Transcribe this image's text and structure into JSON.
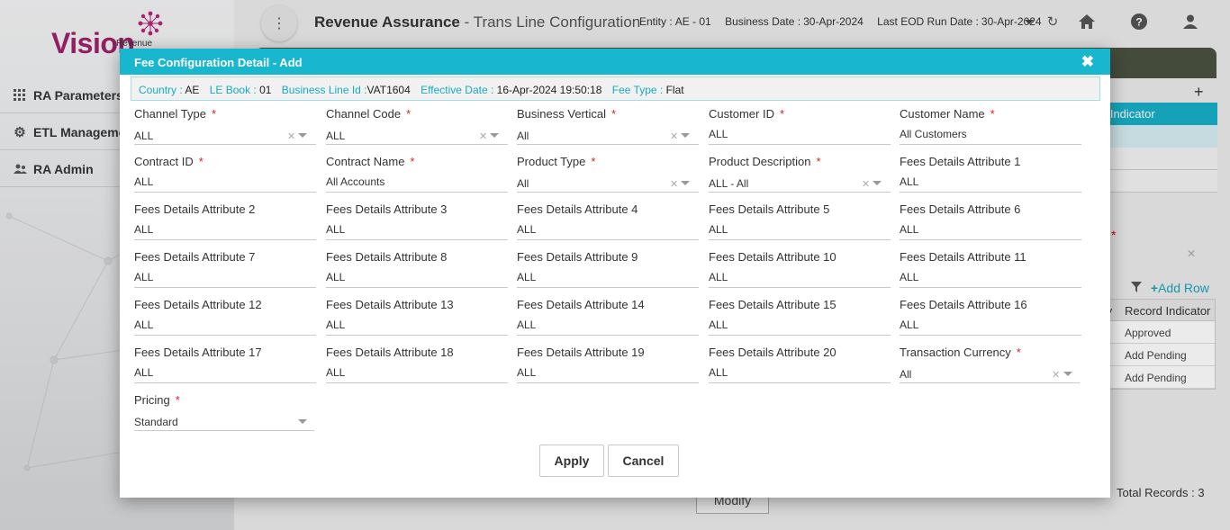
{
  "sidebar": {
    "logo_text": "Vision",
    "logo_sub": "Revenue",
    "items": [
      {
        "label": "RA Parameters",
        "icon": "grid-icon"
      },
      {
        "label": "ETL Manageme",
        "icon": "gear-icon"
      },
      {
        "label": "RA Admin",
        "icon": "users-icon"
      }
    ]
  },
  "header": {
    "title_bold": "Revenue Assurance",
    "title_rest": " - Trans Line Configuration",
    "entity_label": "Entity :",
    "entity_value": "AE - 01",
    "business_date_label": "Business Date :",
    "business_date_value": "30-Apr-2024",
    "eod_label": "Last EOD Run Date :",
    "eod_value": "30-Apr-2024"
  },
  "background": {
    "indicator_header": "d Indicator",
    "add_row_label": "Add Row",
    "record_indicator_header": "Record Indicator",
    "header_cut": "fy",
    "rows": [
      "Approved",
      "Add Pending",
      "Add Pending"
    ],
    "total_records_label": "Total Records",
    "total_records_value": "3",
    "modify_label": "Modify"
  },
  "modal": {
    "title": "Fee Configuration Detail - Add",
    "info": {
      "country_label": "Country :",
      "country_value": "AE",
      "le_book_label": "LE Book :",
      "le_book_value": "01",
      "business_line_label": "Business Line Id :",
      "business_line_value": "VAT1604",
      "effective_date_label": "Effective Date :",
      "effective_date_value": "16-Apr-2024 19:50:18",
      "fee_type_label": "Fee Type :",
      "fee_type_value": "Flat"
    },
    "fields": {
      "channel_type": {
        "label": "Channel Type",
        "value": "ALL"
      },
      "channel_code": {
        "label": "Channel Code",
        "value": "ALL"
      },
      "business_vertical": {
        "label": "Business Vertical",
        "value": "All"
      },
      "customer_id": {
        "label": "Customer ID",
        "value": "ALL"
      },
      "customer_name": {
        "label": "Customer Name",
        "value": "All Customers"
      },
      "contract_id": {
        "label": "Contract ID",
        "value": "ALL"
      },
      "contract_name": {
        "label": "Contract Name",
        "value": "All Accounts"
      },
      "product_type": {
        "label": "Product Type",
        "value": "All"
      },
      "product_description": {
        "label": "Product Description",
        "value": "ALL - All"
      },
      "attr1": {
        "label": "Fees Details Attribute 1",
        "value": "ALL"
      },
      "attr2": {
        "label": "Fees Details Attribute 2",
        "value": "ALL"
      },
      "attr3": {
        "label": "Fees Details Attribute 3",
        "value": "ALL"
      },
      "attr4": {
        "label": "Fees Details Attribute 4",
        "value": "ALL"
      },
      "attr5": {
        "label": "Fees Details Attribute 5",
        "value": "ALL"
      },
      "attr6": {
        "label": "Fees Details Attribute 6",
        "value": "ALL"
      },
      "attr7": {
        "label": "Fees Details Attribute 7",
        "value": "ALL"
      },
      "attr8": {
        "label": "Fees Details Attribute 8",
        "value": "ALL"
      },
      "attr9": {
        "label": "Fees Details Attribute 9",
        "value": "ALL"
      },
      "attr10": {
        "label": "Fees Details Attribute 10",
        "value": "ALL"
      },
      "attr11": {
        "label": "Fees Details Attribute 11",
        "value": "ALL"
      },
      "attr12": {
        "label": "Fees Details Attribute 12",
        "value": "ALL"
      },
      "attr13": {
        "label": "Fees Details Attribute 13",
        "value": "ALL"
      },
      "attr14": {
        "label": "Fees Details Attribute 14",
        "value": "ALL"
      },
      "attr15": {
        "label": "Fees Details Attribute 15",
        "value": "ALL"
      },
      "attr16": {
        "label": "Fees Details Attribute 16",
        "value": "ALL"
      },
      "attr17": {
        "label": "Fees Details Attribute 17",
        "value": "ALL"
      },
      "attr18": {
        "label": "Fees Details Attribute 18",
        "value": "ALL"
      },
      "attr19": {
        "label": "Fees Details Attribute 19",
        "value": "ALL"
      },
      "attr20": {
        "label": "Fees Details Attribute 20",
        "value": "ALL"
      },
      "transaction_currency": {
        "label": "Transaction Currency",
        "value": "All"
      },
      "pricing": {
        "label": "Pricing",
        "value": "Standard"
      }
    },
    "required_mark": "*",
    "apply_label": "Apply",
    "cancel_label": "Cancel"
  },
  "colors": {
    "accent": "#19b6d0",
    "brand": "#a0216c",
    "required": "#d22222"
  }
}
